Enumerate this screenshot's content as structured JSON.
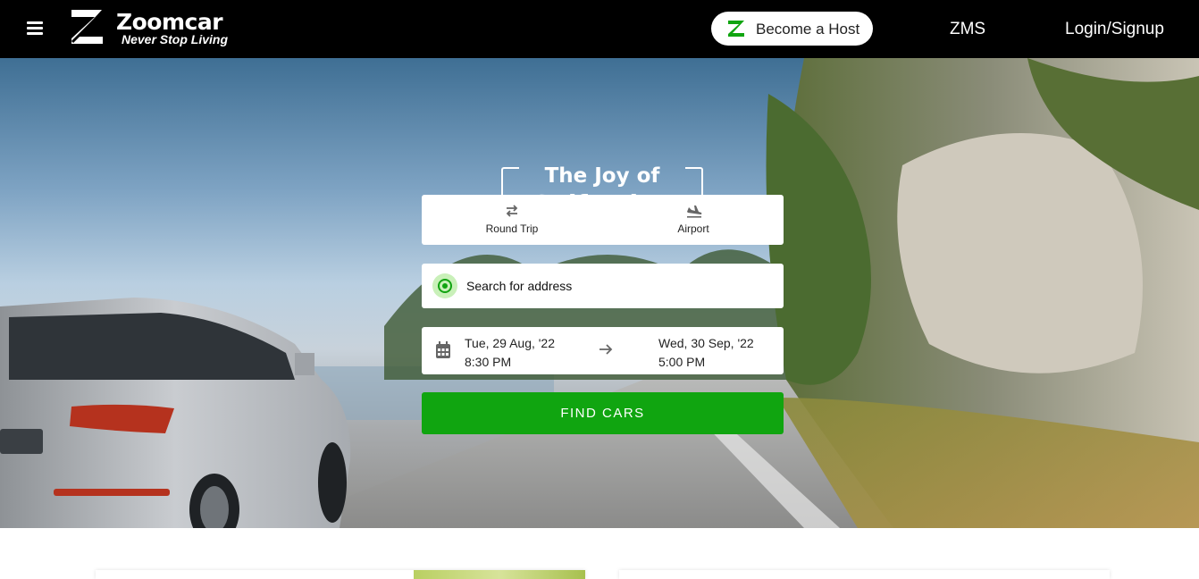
{
  "header": {
    "brand_name": "Zoomcar",
    "brand_tagline": "Never Stop Living",
    "become_host_label": "Become a Host",
    "zms_label": "ZMS",
    "login_label": "Login/Signup"
  },
  "hero": {
    "title_line1": "The Joy of",
    "title_line2": "Self Drive"
  },
  "trip_types": [
    {
      "label": "Round Trip",
      "icon": "swap-arrows-icon"
    },
    {
      "label": "Airport",
      "icon": "airplane-landing-icon"
    }
  ],
  "search": {
    "placeholder": "Search for address"
  },
  "dates": {
    "start_date": "Tue, 29 Aug, '22",
    "start_time": "8:30 PM",
    "end_date": "Wed, 30 Sep, '22",
    "end_time": "5:00 PM"
  },
  "find_button_label": "FIND CARS",
  "colors": {
    "brand_green": "#10a510",
    "header_bg": "#000000"
  }
}
